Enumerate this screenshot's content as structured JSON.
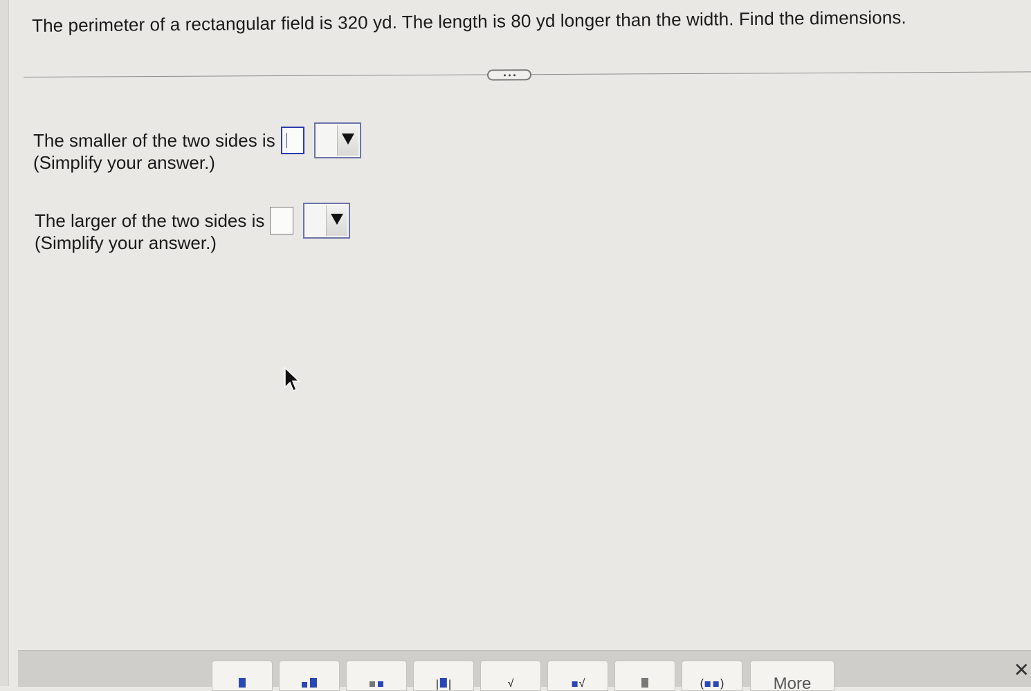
{
  "question": {
    "text": "The perimeter of a rectangular field is 320 yd. The length is 80 yd longer than the width. Find the dimensions."
  },
  "divider": {
    "icon": "more-dots-icon"
  },
  "answers": [
    {
      "label": "The smaller of the two sides is",
      "hint": "(Simplify your answer.)",
      "value": "",
      "unit": ""
    },
    {
      "label": "The larger of the two sides is",
      "hint": "(Simplify your answer.)",
      "value": "",
      "unit": ""
    }
  ],
  "toolbar": {
    "buttons": [
      "fraction-icon",
      "mixed-number-icon",
      "exponent-icon",
      "absolute-value-icon",
      "square-root-icon",
      "nth-root-icon",
      "decimal-icon",
      "ordered-pair-icon"
    ],
    "more_label": "More",
    "close_icon": "close-icon"
  },
  "colors": {
    "active_input": "#2b3cae",
    "button_blue": "#2a48b5",
    "background": "#e9e8e5"
  }
}
